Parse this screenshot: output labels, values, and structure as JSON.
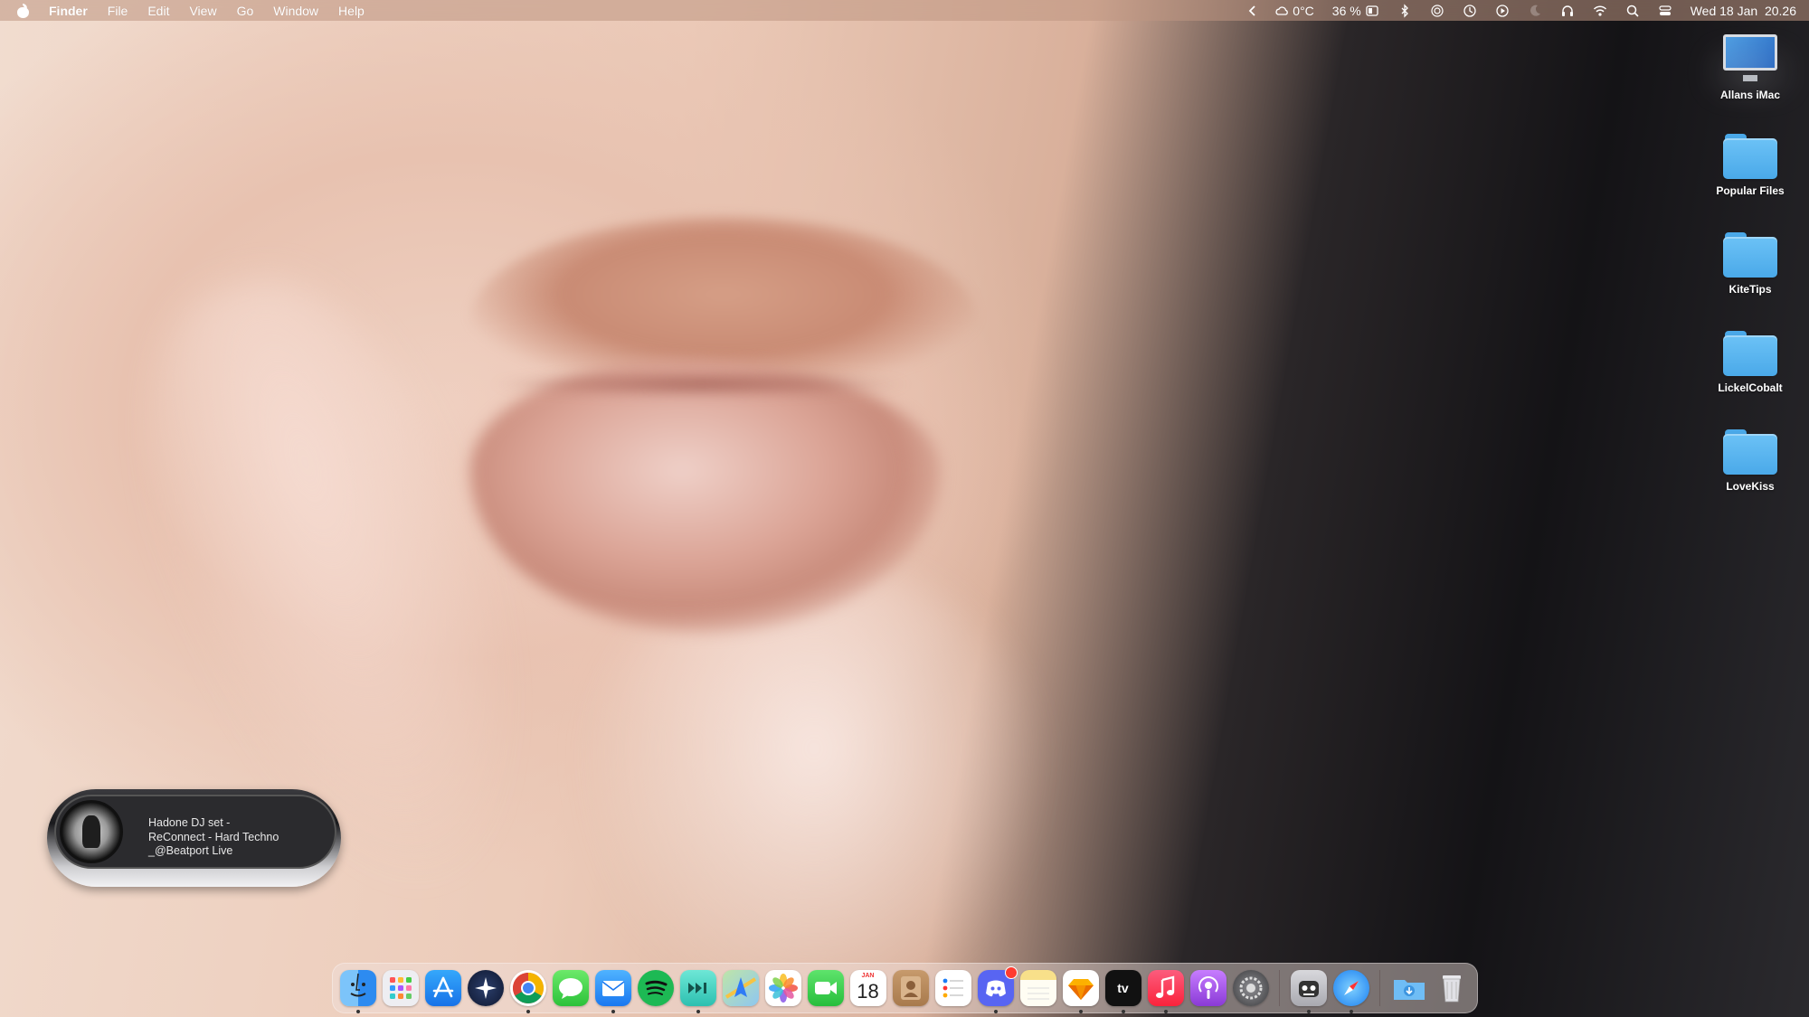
{
  "menubar": {
    "app_name": "Finder",
    "menus": [
      "File",
      "Edit",
      "View",
      "Go",
      "Window",
      "Help"
    ],
    "weather": "0°C",
    "battery": "36 %",
    "datetime": "Wed 18 Jan  20.26"
  },
  "desktop": {
    "items": [
      {
        "label": "Allans iMac",
        "icon": "imac-icon"
      },
      {
        "label": "Popular Files",
        "icon": "folder-icon"
      },
      {
        "label": "KiteTips",
        "icon": "folder-icon"
      },
      {
        "label": "LickelCobalt",
        "icon": "folder-icon"
      },
      {
        "label": "LoveKiss",
        "icon": "folder-icon"
      }
    ]
  },
  "now_playing": {
    "line1": "Hadone DJ set -",
    "line2": "ReConnect - Hard Techno",
    "line3": "_@Beatport Live"
  },
  "dock": {
    "calendar_month": "JAN",
    "calendar_day": "18",
    "appletv_label": "tv",
    "colors": {
      "finder": "#2d8bf0",
      "launchpad": "#e9e9ee",
      "appstore": "#1f8ff5",
      "spotify": "#1db954",
      "discord": "#5865f2",
      "music": "#fa3c55",
      "podcasts": "#9b4de0"
    }
  }
}
